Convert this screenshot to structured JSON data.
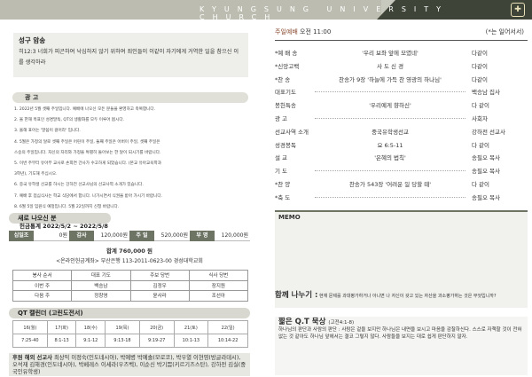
{
  "header": {
    "title": "KYUNGSUNG UNIVERSITY CHURCH"
  },
  "scripture": {
    "heading": "성구 암송",
    "text": "히12:3 너희가 피곤하여 낙심하지 않기 위하여 죄인들이 이같이 자기에게 거역한 일을 참으신 이를 생각하라"
  },
  "announcements": {
    "heading": "광  고",
    "items": [
      "1. 2022년 5월 셋째 주일입니다. 예배에 나오신 모든 분들을 환영하고 축복합니다.",
      "2. 올 한해 목표인 성경말독, QT의 생활화를 모두 이루어 봅시다.",
      "3. 올해 표어는 '말씀이 걸어라' 입니다.",
      "4. 5월은 가정의 달로 셋째 주일은 어린이 주일, 둘째 주일은 어버이 주일, 셋째 주일은",
      "스승의 주일입니다. 자신의 자리와 가정을 특별히 돌아보는 한 달이 되시기를 바랍니다.",
      "5. 이번 주부터 유아부 교사로 손희연 간사가 수고하게 되었습니다. (본교 유아교육학과",
      "3학년), 기도해 주십시오.",
      "6. 중국 유학생 선교를 하시는 강하전 선교사님의 선교사역 소개가 있습니다.",
      "7. 예배 후 점심식사는 학교 식당에서 합니다. 나가시면서 식권을 받아 가시기 바랍니다.",
      "8. 6월 5일 임원식 예정입니다. 5월 22일까지 신청 바랍니다."
    ]
  },
  "visitors": {
    "heading": "새로 나오신 분"
  },
  "finance": {
    "heading": "헌금통계 2022/5/2 ~ 2022/5/8",
    "items": [
      {
        "label": "십일조",
        "value": "0원"
      },
      {
        "label": "감사",
        "value": "120,000원"
      },
      {
        "label": "주 일",
        "value": "520,000원"
      },
      {
        "label": "부 명",
        "value": "120,000원"
      }
    ],
    "total": "합계  760,000 원",
    "account": "<온라인헌금계좌> 부산은행 113-2011-0623-00 경성대학교회"
  },
  "duty": {
    "headers": [
      "봉사 순서",
      "대표 기도",
      "주보 당번",
      "식사 당번"
    ],
    "rows": [
      [
        "이번 주",
        "백승남",
        "김정우",
        "장지원"
      ],
      [
        "다음 주",
        "정창영",
        "윤사라",
        "조선아"
      ]
    ]
  },
  "qt_calendar": {
    "heading": "QT 캘린더 (고린도전서)",
    "days": [
      "16(월)",
      "17(화)",
      "18(수)",
      "19(목)",
      "20(금)",
      "21(토)",
      "22(일)"
    ],
    "refs": [
      "7:25-40",
      "8:1-13",
      "9:1-12",
      "9:13-18",
      "9:19-27",
      "10:1-13",
      "10:14-22"
    ]
  },
  "missionaries": {
    "label": "후원 해외 선교사",
    "text": "최상익 이정숙(인도네시아), 박예병 박예솔(모로코), 박우열 이현영(방글라데시), 오석재 김해경(인도네시아), 박베레스 이세라(우즈벡), 이순신 박기쁨(키르기즈스탄), 강하전 김실(중국인유학생)"
  },
  "worship": {
    "heading": "주일예배",
    "time": "오전 11:00",
    "note": "(*는 일어서서)",
    "order": [
      {
        "name": "*예 배 송",
        "content": "'우리 보좌 앞에 모였네'",
        "person": "다같이"
      },
      {
        "name": "*신앙고백",
        "content": "사 도 신 경",
        "person": "다같이"
      },
      {
        "name": "*찬    송",
        "content": "찬송가 9장 '하늘에 가득 찬 영광의 하나님'",
        "person": "다같이"
      },
      {
        "name": "대표기도",
        "content": "",
        "person": "백승남 집사"
      },
      {
        "name": "봉헌특송",
        "content": "'우리예게 향하신'",
        "person": "다 같이"
      },
      {
        "name": "광    고",
        "content": "",
        "person": "사회자"
      },
      {
        "name": "선교사역 소개",
        "content": "중국유학생선교",
        "person": "강하전 선교사"
      },
      {
        "name": "성경봉독",
        "content": "요 6:5-11",
        "person": "다 같이"
      },
      {
        "name": "설    교",
        "content": "'은혜의 법칙'",
        "person": "송필오 목사"
      },
      {
        "name": "기    도",
        "content": "",
        "person": "송필오 목사"
      },
      {
        "name": "*찬    양",
        "content": "찬송가 543장 '어려운 일 당할 때'",
        "person": "다 같이"
      },
      {
        "name": "*축    도",
        "content": "",
        "person": "송필오 목사"
      }
    ]
  },
  "memo": {
    "heading": "MEMO"
  },
  "reflection": {
    "heading": "함께 나누기 :",
    "text": "현재 문제를 과대평가하거나 아니면 나 자신이 갖고 있는 자산을 과소평가하는 것은 무엇입니까?"
  },
  "short_qt": {
    "heading": "짧은 Q.T 묵상",
    "ref": "(고전4:1-8)",
    "text": "하나님의 판단과 사람의 판단 : 사람은 겉을 보지만 하나님은 내면을 보시고 마음을 감찰하신다. 스스로 자책할 것이 전혀 없는 것 같아도 하나님 앞에서는 결코 그렇지 않다. 사람들을 보지는 대로 쉽게 판단하지 말자."
  },
  "colors": {
    "accent": "#6d7464",
    "banner": "#3e4438"
  }
}
